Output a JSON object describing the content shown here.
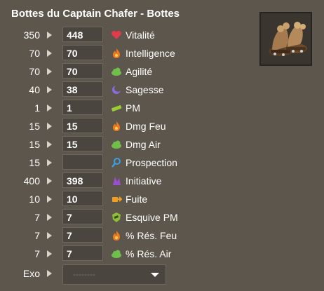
{
  "title": "Bottes du Captain Chafer - Bottes",
  "item_icon": "boots-icon",
  "stats": [
    {
      "base": "350",
      "value": "448",
      "label": "Vitalité",
      "icon": "heart-icon",
      "color": "#e23b4c"
    },
    {
      "base": "70",
      "value": "70",
      "label": "Intelligence",
      "icon": "fire-icon",
      "color": "#f07a1c"
    },
    {
      "base": "70",
      "value": "70",
      "label": "Agilité",
      "icon": "cloud-icon",
      "color": "#6fbf4a"
    },
    {
      "base": "40",
      "value": "38",
      "label": "Sagesse",
      "icon": "moon-icon",
      "color": "#8a6ce0"
    },
    {
      "base": "1",
      "value": "1",
      "label": "PM",
      "icon": "pm-icon",
      "color": "#9acd32"
    },
    {
      "base": "15",
      "value": "15",
      "label": "Dmg Feu",
      "icon": "fire-damage-icon",
      "color": "#f07a1c"
    },
    {
      "base": "15",
      "value": "15",
      "label": "Dmg Air",
      "icon": "air-damage-icon",
      "color": "#6fbf4a"
    },
    {
      "base": "15",
      "value": "",
      "label": "Prospection",
      "icon": "magnifier-icon",
      "color": "#3aa0e0"
    },
    {
      "base": "400",
      "value": "398",
      "label": "Initiative",
      "icon": "initiative-icon",
      "color": "#9b4fd0"
    },
    {
      "base": "10",
      "value": "10",
      "label": "Fuite",
      "icon": "flee-icon",
      "color": "#f0a020"
    },
    {
      "base": "7",
      "value": "7",
      "label": "Esquive PM",
      "icon": "dodge-pm-icon",
      "color": "#8dbf3a"
    },
    {
      "base": "7",
      "value": "7",
      "label": "% Rés. Feu",
      "icon": "fire-resist-icon",
      "color": "#f07a1c"
    },
    {
      "base": "7",
      "value": "7",
      "label": "% Rés. Air",
      "icon": "air-resist-icon",
      "color": "#6fbf4a"
    }
  ],
  "exo": {
    "label": "Exo",
    "placeholder": "--------"
  }
}
